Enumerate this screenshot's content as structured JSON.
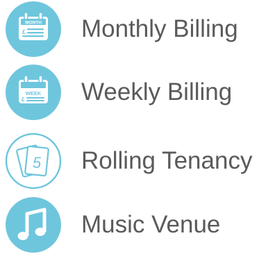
{
  "colors": {
    "icon_fill": "#6ec6dd",
    "icon_fill_dark": "#4aaecb",
    "icon_white": "#ffffff",
    "label_text": "#5a5a5a"
  },
  "items": [
    {
      "label": "Monthly Billing",
      "icon": "calendar-month-icon",
      "icon_text": "MONTH",
      "icon_currency": "£"
    },
    {
      "label": "Weekly Billing",
      "icon": "calendar-week-icon",
      "icon_text": "WEEK",
      "icon_currency": "£"
    },
    {
      "label": "Rolling Tenancy",
      "icon": "rolling-cards-icon",
      "icon_text": "5"
    },
    {
      "label": "Music Venue",
      "icon": "music-note-icon"
    }
  ]
}
